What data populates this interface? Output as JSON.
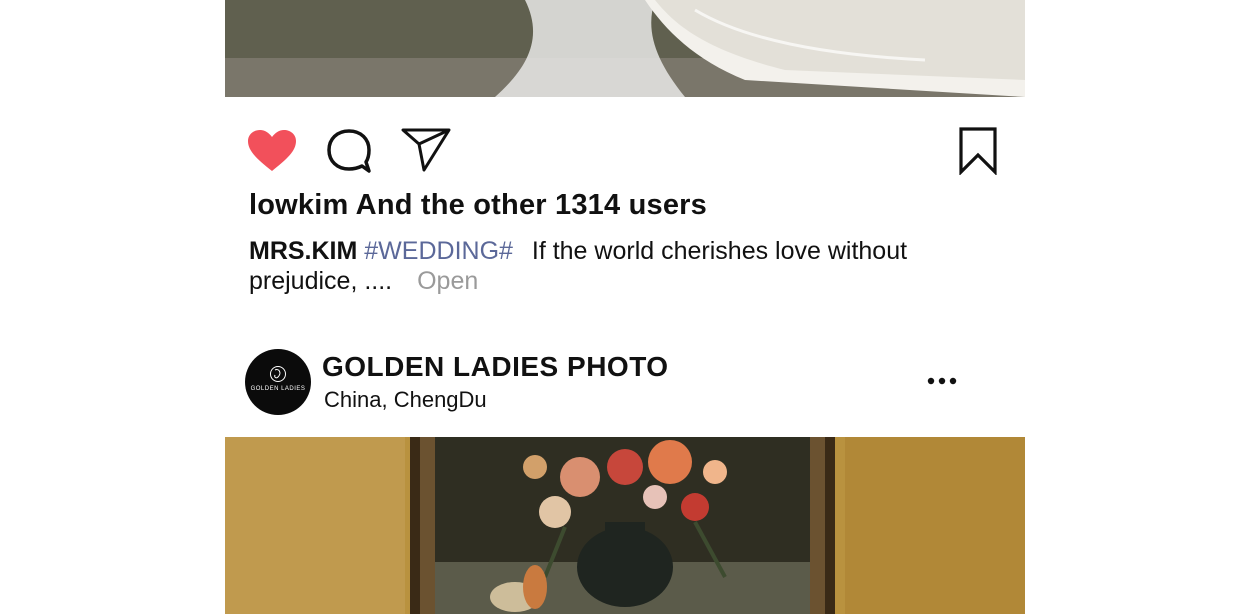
{
  "post_top": {
    "likes_text": "lowkim And the other 1314 users",
    "caption": {
      "username": "MRS.KIM",
      "hashtag": "#WEDDING#",
      "text": "If the world cherishes love without prejudice, ....",
      "open_label": "Open"
    },
    "icons": {
      "like": "heart-icon",
      "comment": "comment-bubble-icon",
      "share": "send-paper-plane-icon",
      "save": "bookmark-icon"
    },
    "colors": {
      "liked_heart": "#f2505b",
      "hashtag": "#5b6899",
      "open_link": "#9a9a9a"
    }
  },
  "post_next": {
    "account_name": "GOLDEN LADIES PHOTO",
    "location": "China,  ChengDu",
    "avatar_logo_text": "GOLDEN LADIES",
    "more_icon": "more-horizontal-icon"
  }
}
